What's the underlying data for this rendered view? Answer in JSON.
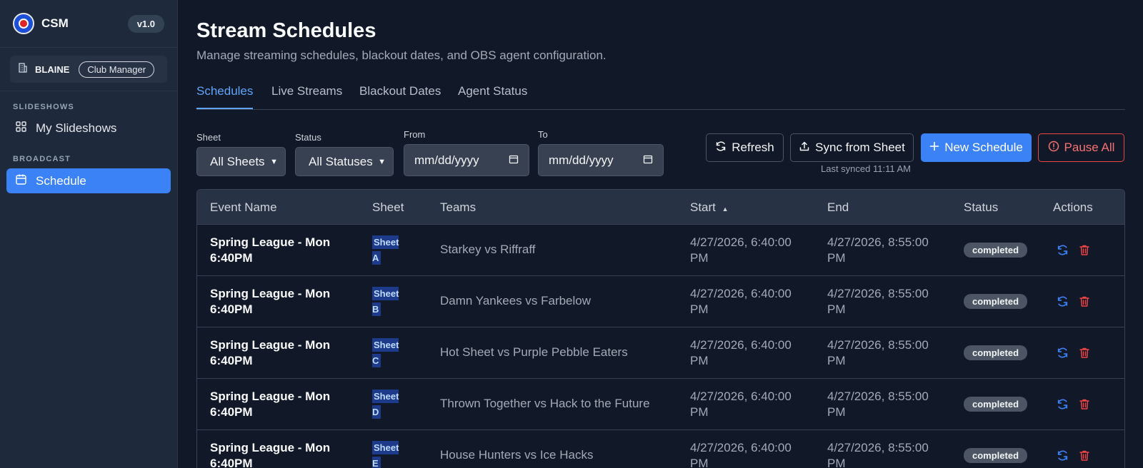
{
  "app": {
    "name": "CSM",
    "version": "v1.0"
  },
  "club": {
    "name": "BLAINE",
    "role": "Club Manager"
  },
  "sidebar": {
    "sections": [
      {
        "label": "SLIDESHOWS",
        "items": [
          {
            "label": "My Slideshows",
            "icon": "grid-icon",
            "active": false
          }
        ]
      },
      {
        "label": "BROADCAST",
        "items": [
          {
            "label": "Schedule",
            "icon": "calendar-icon",
            "active": true
          }
        ]
      }
    ]
  },
  "page": {
    "title": "Stream Schedules",
    "subtitle": "Manage streaming schedules, blackout dates, and OBS agent configuration."
  },
  "tabs": [
    "Schedules",
    "Live Streams",
    "Blackout Dates",
    "Agent Status"
  ],
  "filters": {
    "sheet_label": "Sheet",
    "sheet_value": "All Sheets",
    "status_label": "Status",
    "status_value": "All Statuses",
    "from_label": "From",
    "from_placeholder": "mm/dd/yyyy",
    "to_label": "To",
    "to_placeholder": "mm/dd/yyyy"
  },
  "actions": {
    "refresh": "Refresh",
    "sync": "Sync from Sheet",
    "new": "New Schedule",
    "pause": "Pause All",
    "last_synced": "Last synced 11:11 AM"
  },
  "table": {
    "columns": [
      "Event Name",
      "Sheet",
      "Teams",
      "Start",
      "End",
      "Status",
      "Actions"
    ],
    "sort_indicator": "▲",
    "rows": [
      {
        "event": "Spring League - Mon 6:40PM",
        "sheet": "Sheet A",
        "teams": "Starkey vs Riffraff",
        "start": "4/27/2026, 6:40:00 PM",
        "end": "4/27/2026, 8:55:00 PM",
        "status": "completed"
      },
      {
        "event": "Spring League - Mon 6:40PM",
        "sheet": "Sheet B",
        "teams": "Damn Yankees vs Farbelow",
        "start": "4/27/2026, 6:40:00 PM",
        "end": "4/27/2026, 8:55:00 PM",
        "status": "completed"
      },
      {
        "event": "Spring League - Mon 6:40PM",
        "sheet": "Sheet C",
        "teams": "Hot Sheet vs Purple Pebble Eaters",
        "start": "4/27/2026, 6:40:00 PM",
        "end": "4/27/2026, 8:55:00 PM",
        "status": "completed"
      },
      {
        "event": "Spring League - Mon 6:40PM",
        "sheet": "Sheet D",
        "teams": "Thrown Together vs Hack to the Future",
        "start": "4/27/2026, 6:40:00 PM",
        "end": "4/27/2026, 8:55:00 PM",
        "status": "completed"
      },
      {
        "event": "Spring League - Mon 6:40PM",
        "sheet": "Sheet E",
        "teams": "House Hunters vs Ice Hacks",
        "start": "4/27/2026, 6:40:00 PM",
        "end": "4/27/2026, 8:55:00 PM",
        "status": "completed"
      }
    ]
  },
  "colors": {
    "accent": "#3b82f6",
    "danger": "#ef4444",
    "background": "#111827",
    "sidebar": "#1e293b"
  }
}
